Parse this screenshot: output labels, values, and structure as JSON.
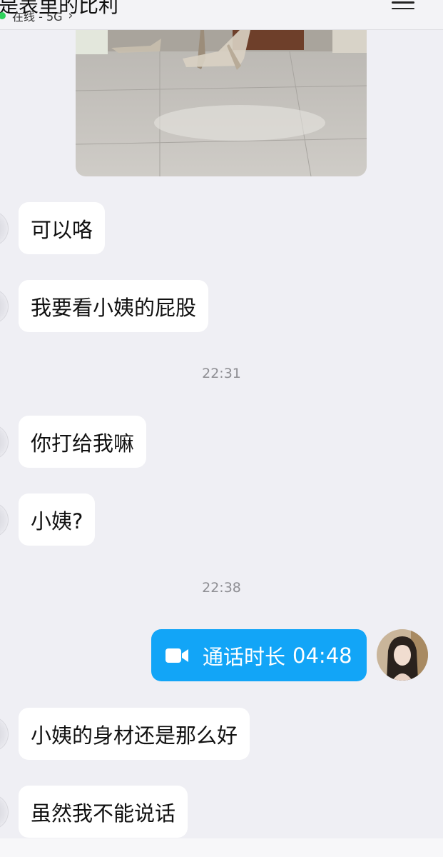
{
  "header": {
    "title": "是表里的比利",
    "status": "在线 - 5G",
    "status_chevron": "›"
  },
  "messages": [
    {
      "type": "incoming",
      "text": "可以咯"
    },
    {
      "type": "incoming",
      "text": "我要看小姨的屁股"
    },
    {
      "type": "time",
      "text": "22:31"
    },
    {
      "type": "incoming",
      "text": "你打给我嘛"
    },
    {
      "type": "incoming",
      "text": "小姨?"
    },
    {
      "type": "time",
      "text": "22:38"
    },
    {
      "type": "outgoing_call",
      "label": "通话时长",
      "duration": "04:48"
    },
    {
      "type": "incoming",
      "text": "小姨的身材还是那么好"
    },
    {
      "type": "incoming",
      "text": "虽然我不能说话"
    }
  ],
  "colors": {
    "background": "#efeff4",
    "bubble_in": "#ffffff",
    "bubble_out": "#12a5f7",
    "online_dot": "#2fd15c"
  },
  "icons": {
    "menu": "hamburger-menu-icon",
    "call": "video-camera-icon"
  }
}
